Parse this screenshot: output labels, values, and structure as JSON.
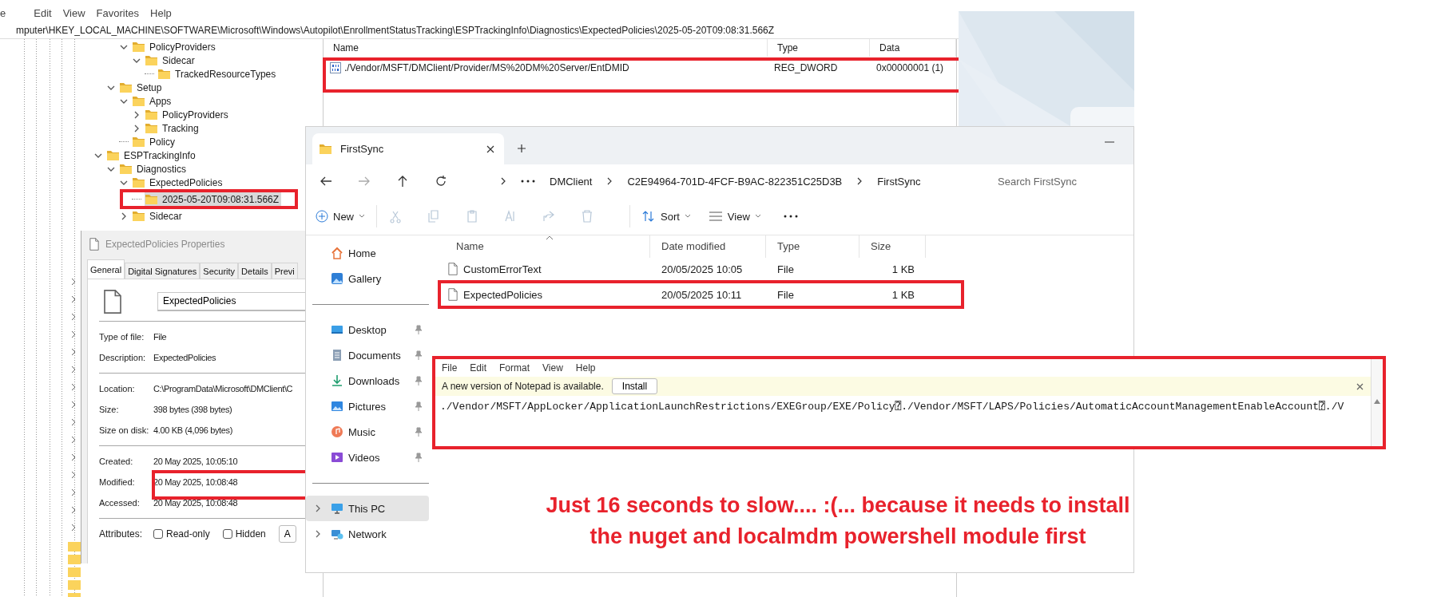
{
  "registry": {
    "menu": [
      "e",
      "Edit",
      "View",
      "Favorites",
      "Help"
    ],
    "address": "mputer\\HKEY_LOCAL_MACHINE\\SOFTWARE\\Microsoft\\Windows\\Autopilot\\EnrollmentStatusTracking\\ESPTrackingInfo\\Diagnostics\\ExpectedPolicies\\2025-05-20T09:08:31.566Z",
    "tree": [
      {
        "children": [
          {
            "children": [
              {
                "label": "PolicyProviders",
                "expanded": true,
                "selected": false,
                "children": [
                  {
                    "label": "Sidecar",
                    "expanded": true,
                    "selected": false,
                    "children": [
                      {
                        "label": "TrackedResourceTypes",
                        "selected": false
                      }
                    ]
                  }
                ]
              }
            ]
          },
          {
            "label": "Setup",
            "expanded": true,
            "selected": false,
            "children": [
              {
                "label": "Apps",
                "expanded": true,
                "selected": false,
                "children": [
                  {
                    "label": "PolicyProviders",
                    "expanded": false,
                    "selected": false
                  },
                  {
                    "label": "Tracking",
                    "expanded": false,
                    "selected": false
                  }
                ]
              },
              {
                "label": "Policy",
                "selected": false
              }
            ]
          }
        ]
      },
      {
        "label": "ESPTrackingInfo",
        "expanded": true,
        "selected": false,
        "children": [
          {
            "label": "Diagnostics",
            "expanded": true,
            "selected": false,
            "children": [
              {
                "label": "ExpectedPolicies",
                "expanded": true,
                "selected": false,
                "children": [
                  {
                    "label": "2025-05-20T09:08:31.566Z",
                    "selected": true,
                    "highlighted": true
                  }
                ]
              },
              {
                "label": "Sidecar",
                "expanded": false,
                "selected": false
              }
            ]
          }
        ]
      }
    ],
    "columns": [
      "Name",
      "Type",
      "Data"
    ],
    "values": [
      {
        "name": "./Vendor/MSFT/DMClient/Provider/MS%20DM%20Server/EntDMID",
        "type": "REG_DWORD",
        "data": "0x00000001 (1)",
        "selected": false,
        "highlighted": true
      }
    ]
  },
  "properties": {
    "title": "ExpectedPolicies Properties",
    "tabs": [
      {
        "label": "General",
        "selected": true
      },
      {
        "label": "Digital Signatures",
        "selected": false
      },
      {
        "label": "Security",
        "selected": false
      },
      {
        "label": "Details",
        "selected": false
      },
      {
        "label": "Previ",
        "selected": false
      }
    ],
    "name": "ExpectedPolicies",
    "groups": [
      [
        {
          "label": "Type of file:",
          "value": "File"
        },
        {
          "label": "Description:",
          "value": "ExpectedPolicies"
        }
      ],
      [
        {
          "label": "Location:",
          "value": "C:\\ProgramData\\Microsoft\\DMClient\\C"
        },
        {
          "label": "Size:",
          "value": "398 bytes (398 bytes)"
        },
        {
          "label": "Size on disk:",
          "value": "4.00 KB (4,096 bytes)"
        }
      ],
      [
        {
          "label": "Created:",
          "value": "20 May 2025, 10:05:10"
        },
        {
          "label": "Modified:",
          "value": "20 May 2025, 10:08:48",
          "highlighted": true
        },
        {
          "label": "Accessed:",
          "value": "20 May 2025, 10:08:48"
        }
      ]
    ],
    "attributes": {
      "label": "Attributes:",
      "checkboxes": [
        {
          "label": "Read-only",
          "checked": false
        },
        {
          "label": "Hidden",
          "checked": false
        }
      ],
      "button": "A"
    }
  },
  "explorer": {
    "tab": "FirstSync",
    "path": [
      "DMClient",
      "C2E94964-701D-4FCF-B9AC-822351C25D3B",
      "FirstSync"
    ],
    "search": {
      "placeholder": "Search FirstSync"
    },
    "toolbar": {
      "new": "New",
      "sort": "Sort",
      "view": "View"
    },
    "sidebar": {
      "quick": [
        {
          "label": "Home",
          "selected": false
        },
        {
          "label": "Gallery",
          "selected": false
        }
      ],
      "pinned": [
        {
          "label": "Desktop",
          "pinned": true,
          "selected": false
        },
        {
          "label": "Documents",
          "pinned": true,
          "selected": false
        },
        {
          "label": "Downloads",
          "pinned": true,
          "selected": false
        },
        {
          "label": "Pictures",
          "pinned": true,
          "selected": false
        },
        {
          "label": "Music",
          "pinned": true,
          "selected": false
        },
        {
          "label": "Videos",
          "pinned": true,
          "selected": false
        }
      ],
      "locations": [
        {
          "label": "This PC",
          "expanded": false,
          "selected": true
        },
        {
          "label": "Network",
          "expanded": false,
          "selected": false
        }
      ]
    },
    "columns": [
      "Name",
      "Date modified",
      "Type",
      "Size"
    ],
    "files": [
      {
        "name": "CustomErrorText",
        "date": "20/05/2025 10:05",
        "type": "File",
        "size": "1 KB",
        "selected": false,
        "highlighted": false
      },
      {
        "name": "ExpectedPolicies",
        "date": "20/05/2025 10:11",
        "type": "File",
        "size": "1 KB",
        "selected": false,
        "highlighted": true
      }
    ]
  },
  "notepad": {
    "menu": [
      "File",
      "Edit",
      "Format",
      "View",
      "Help"
    ],
    "banner": {
      "message": "A new version of Notepad is available.",
      "button": "Install"
    },
    "text": "./Vendor/MSFT/AppLocker/ApplicationLaunchRestrictions/EXEGroup/EXE/Policy⍰./Vendor/MSFT/LAPS/Policies/AutomaticAccountManagementEnableAccount⍰./V",
    "highlighted": true
  },
  "caption": [
    "Just 16 seconds to slow.... :(... because it needs to install",
    "the nuget and localmdm powershell module first"
  ]
}
